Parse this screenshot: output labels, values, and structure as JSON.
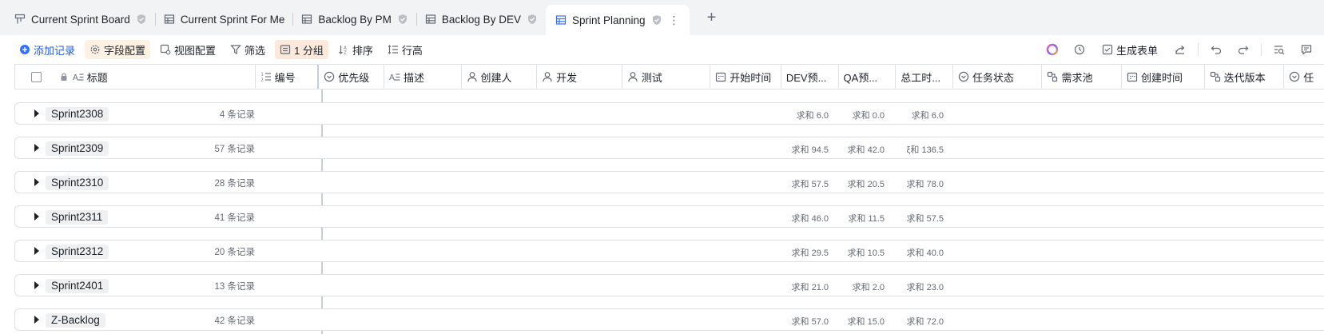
{
  "tabs": [
    {
      "label": "Current Sprint Board",
      "icon": "kanban-icon",
      "verified": true,
      "active": false
    },
    {
      "label": "Current Sprint For Me",
      "icon": "grid-icon",
      "verified": false,
      "active": false
    },
    {
      "label": "Backlog By PM",
      "icon": "grid-icon",
      "verified": true,
      "active": false
    },
    {
      "label": "Backlog By DEV",
      "icon": "grid-icon",
      "verified": true,
      "active": false
    },
    {
      "label": "Sprint Planning",
      "icon": "grid-icon",
      "verified": true,
      "active": true
    }
  ],
  "tab_more": "⋮",
  "tab_add": "+",
  "toolbar": {
    "add_record": "添加记录",
    "field_config": "字段配置",
    "view_config": "视图配置",
    "filter": "筛选",
    "group": "1 分组",
    "sort": "排序",
    "row_height": "行高",
    "generate_form": "生成表单"
  },
  "columns": [
    {
      "label": "标题",
      "icon": "text-icon"
    },
    {
      "label": "编号",
      "icon": "autonumber-icon"
    },
    {
      "label": "优先级",
      "icon": "single-select-icon"
    },
    {
      "label": "描述",
      "icon": "text-icon"
    },
    {
      "label": "创建人",
      "icon": "person-icon"
    },
    {
      "label": "开发",
      "icon": "person-icon"
    },
    {
      "label": "测试",
      "icon": "person-icon"
    },
    {
      "label": "开始时间",
      "icon": "date-icon"
    },
    {
      "label": "DEV预...",
      "icon": ""
    },
    {
      "label": "QA预...",
      "icon": ""
    },
    {
      "label": "总工时...",
      "icon": ""
    },
    {
      "label": "任务状态",
      "icon": "single-select-icon"
    },
    {
      "label": "需求池",
      "icon": "link-icon"
    },
    {
      "label": "创建时间",
      "icon": "date-icon"
    },
    {
      "label": "迭代版本",
      "icon": "link-icon"
    },
    {
      "label": "任",
      "icon": "single-select-icon"
    }
  ],
  "groups": [
    {
      "name": "Sprint2308",
      "count": "4 条记录",
      "dev": "求和 6.0",
      "qa": "求和 0.0",
      "total": "求和 6.0"
    },
    {
      "name": "Sprint2309",
      "count": "57 条记录",
      "dev": "求和 94.5",
      "qa": "求和 42.0",
      "total": "ξ和 136.5"
    },
    {
      "name": "Sprint2310",
      "count": "28 条记录",
      "dev": "求和 57.5",
      "qa": "求和 20.5",
      "total": "求和 78.0"
    },
    {
      "name": "Sprint2311",
      "count": "41 条记录",
      "dev": "求和 46.0",
      "qa": "求和 11.5",
      "total": "求和 57.5"
    },
    {
      "name": "Sprint2312",
      "count": "20 条记录",
      "dev": "求和 29.5",
      "qa": "求和 10.5",
      "total": "求和 40.0"
    },
    {
      "name": "Sprint2401",
      "count": "13 条记录",
      "dev": "求和 21.0",
      "qa": "求和 2.0",
      "total": "求和 23.0"
    },
    {
      "name": "Z-Backlog",
      "count": "42 条记录",
      "dev": "求和 57.0",
      "qa": "求和 15.0",
      "total": "求和 72.0"
    }
  ],
  "colors": {
    "accent": "#3370ff",
    "border": "#dee0e3",
    "muted": "#646a73"
  }
}
